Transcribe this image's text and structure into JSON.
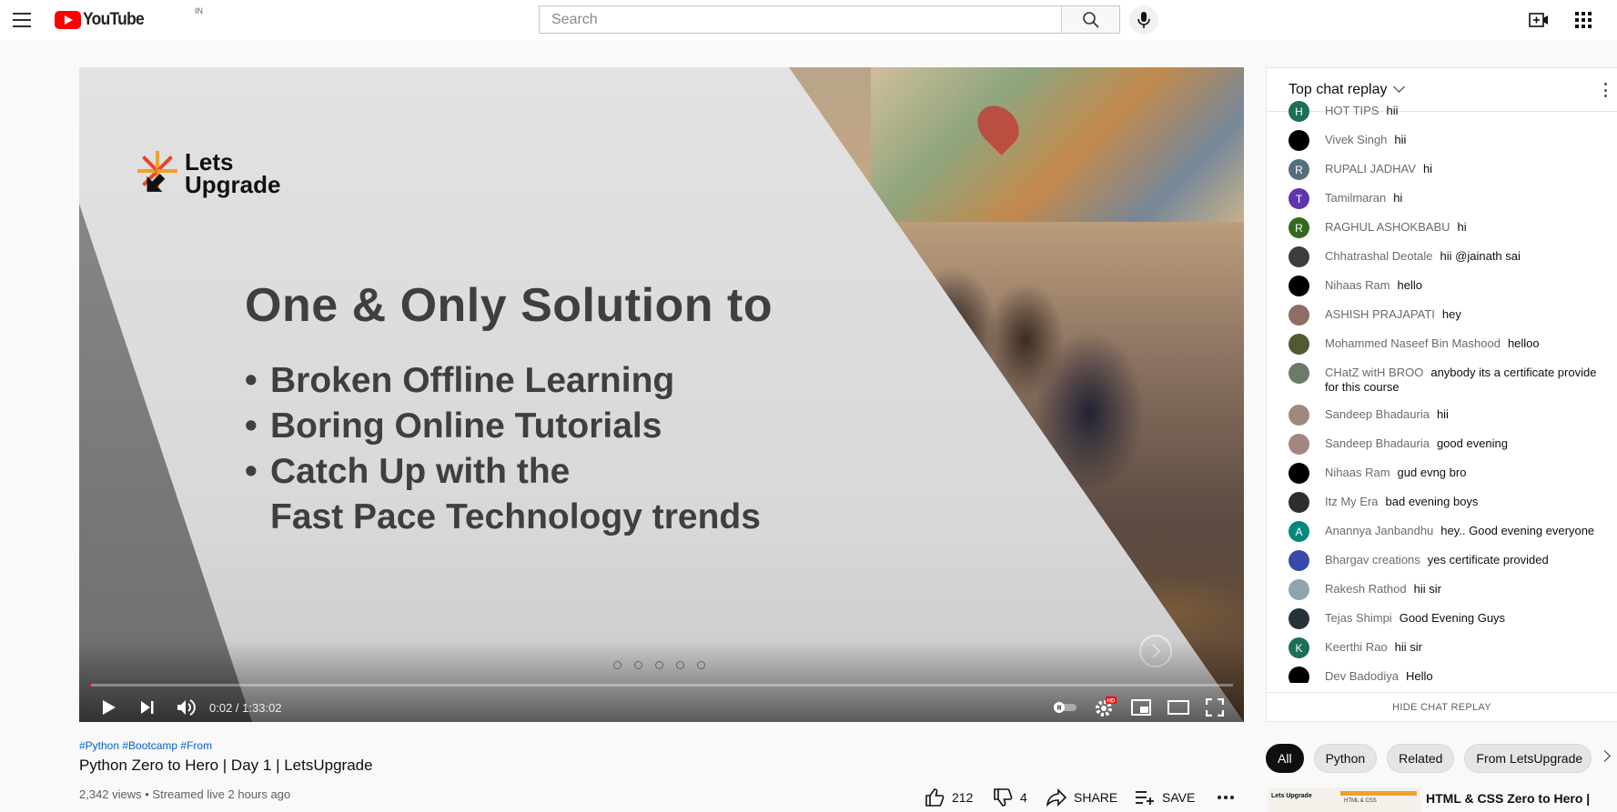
{
  "header": {
    "logo_text": "YouTube",
    "country_code": "IN",
    "search_placeholder": "Search"
  },
  "player": {
    "slide": {
      "brand_line1": "Lets",
      "brand_line2": "Upgrade",
      "heading": "One & Only Solution to",
      "bullets": [
        "Broken Offline Learning",
        "Boring Online Tutorials",
        "Catch Up with the",
        "Fast Pace Technology trends"
      ]
    },
    "time_current": "0:02",
    "time_separator": " / ",
    "time_total": "1:33:02",
    "progress_fraction": 0.0004
  },
  "video": {
    "hashtags": "#Python #Bootcamp #From",
    "title": "Python Zero to Hero | Day 1 | LetsUpgrade",
    "meta": "2,342 views • Streamed live 2 hours ago",
    "likes": "212",
    "dislikes": "4",
    "share_label": "SHARE",
    "save_label": "SAVE"
  },
  "chat": {
    "title": "Top chat replay",
    "hide_label": "HIDE CHAT REPLAY",
    "messages": [
      {
        "author": "HOT TIPS",
        "text": "hii",
        "initial": "H",
        "color": "#1b6e57"
      },
      {
        "author": "Vivek Singh",
        "text": "hii",
        "initial": "",
        "color": "#000000"
      },
      {
        "author": "RUPALI JADHAV",
        "text": "hi",
        "initial": "R",
        "color": "#546e7a"
      },
      {
        "author": "Tamilmaran",
        "text": "hi",
        "initial": "T",
        "color": "#5e35b1"
      },
      {
        "author": "RAGHUL ASHOKBABU",
        "text": "hi",
        "initial": "R",
        "color": "#33691e"
      },
      {
        "author": "Chhatrashal Deotale",
        "text": "hii @jainath sai",
        "initial": "",
        "color": "#3c3c3c"
      },
      {
        "author": "Nihaas Ram",
        "text": "hello",
        "initial": "",
        "color": "#000000"
      },
      {
        "author": "ASHISH PRAJAPATI",
        "text": "hey",
        "initial": "",
        "color": "#8d6e63"
      },
      {
        "author": "Mohammed Naseef Bin Mashood",
        "text": "helloo",
        "initial": "",
        "color": "#4e5b31"
      },
      {
        "author": "CHatZ witH BROO",
        "text": "anybody its a certificate provide for this course",
        "initial": "",
        "color": "#6b7a6a"
      },
      {
        "author": "Sandeep Bhadauria",
        "text": "hii",
        "initial": "",
        "color": "#a1887f"
      },
      {
        "author": "Sandeep Bhadauria",
        "text": "good evening",
        "initial": "",
        "color": "#a1887f"
      },
      {
        "author": "Nihaas Ram",
        "text": "gud evng bro",
        "initial": "",
        "color": "#000000"
      },
      {
        "author": "Itz My Era",
        "text": "bad evening boys",
        "initial": "",
        "color": "#2e2e2e"
      },
      {
        "author": "Anannya Janbandhu",
        "text": "hey.. Good evening everyone",
        "initial": "A",
        "color": "#00897b"
      },
      {
        "author": "Bhargav creations",
        "text": "yes certificate provided",
        "initial": "",
        "color": "#3949ab"
      },
      {
        "author": "Rakesh Rathod",
        "text": "hii sir",
        "initial": "",
        "color": "#90a4ae"
      },
      {
        "author": "Tejas Shimpi",
        "text": "Good Evening Guys",
        "initial": "",
        "color": "#263238"
      },
      {
        "author": "Keerthi Rao",
        "text": "hii sir",
        "initial": "K",
        "color": "#1b6e57"
      },
      {
        "author": "Dev Badodiya",
        "text": "Hello",
        "initial": "",
        "color": "#000000"
      }
    ]
  },
  "chips": [
    "All",
    "Python",
    "Related",
    "From LetsUpgrade"
  ],
  "recommendation": {
    "thumb_brand": "Lets Upgrade",
    "thumb_text": "HTML & CSS",
    "title": "HTML & CSS Zero to Hero |"
  },
  "colors": {
    "brand_red": "#ff0000",
    "link_blue": "#065fd4",
    "chip_active": "#0f0f0f"
  }
}
